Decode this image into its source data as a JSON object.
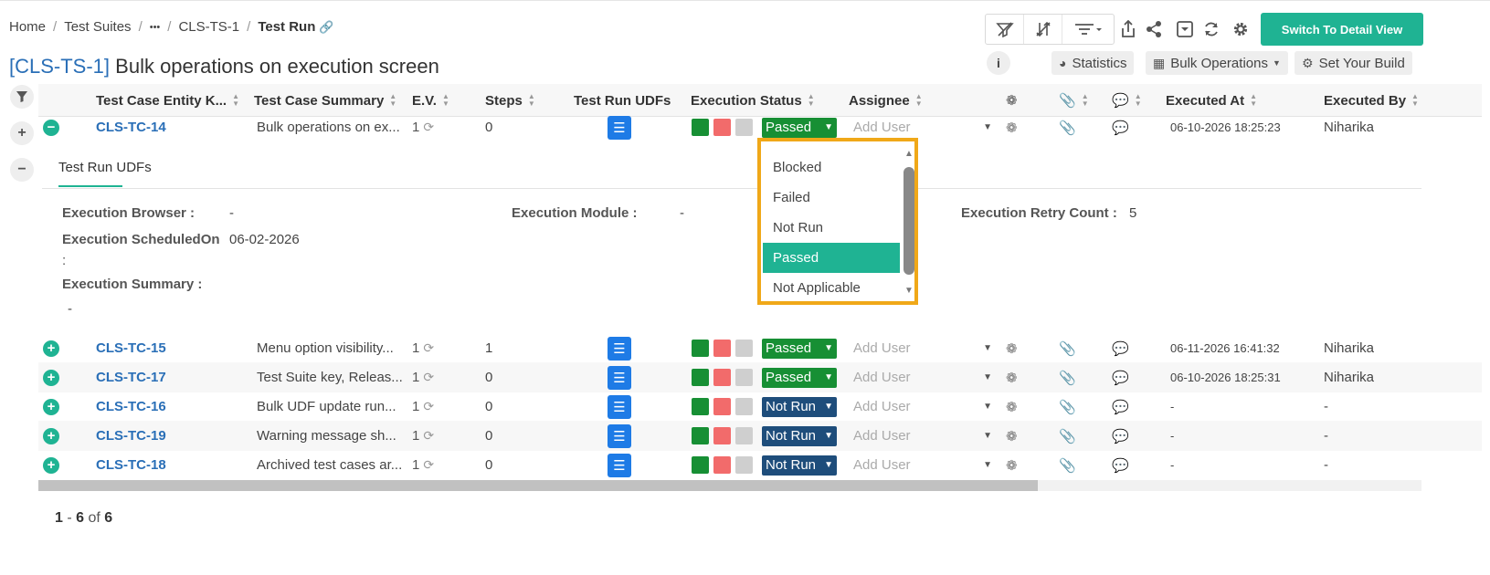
{
  "breadcrumb": {
    "home": "Home",
    "test_suites": "Test Suites",
    "ellipsis": "•••",
    "suite": "CLS-TS-1",
    "current": "Test Run"
  },
  "title": {
    "key": "[CLS-TS-1]",
    "text": "Bulk operations on execution screen"
  },
  "toolbar": {
    "switch_view": "Switch To Detail View",
    "statistics": "Statistics",
    "bulk_operations": "Bulk Operations",
    "set_build": "Set Your Build",
    "info": "i"
  },
  "columns": {
    "key": "Test Case Entity K...",
    "summary": "Test Case Summary",
    "ev": "E.V.",
    "steps": "Steps",
    "udfs": "Test Run UDFs",
    "status": "Execution Status",
    "assignee": "Assignee",
    "executed_at": "Executed At",
    "executed_by": "Executed By"
  },
  "rows": [
    {
      "key": "CLS-TC-14",
      "summary": "Bulk operations on ex...",
      "ev": "1",
      "steps": "0",
      "status": "Passed",
      "assignee": "Add User",
      "executed_at": "06-10-2026 18:25:23",
      "executed_by": "Niharika"
    },
    {
      "key": "CLS-TC-15",
      "summary": "Menu option visibility...",
      "ev": "1",
      "steps": "1",
      "status": "Passed",
      "assignee": "Add User",
      "executed_at": "06-11-2026 16:41:32",
      "executed_by": "Niharika"
    },
    {
      "key": "CLS-TC-17",
      "summary": "Test Suite key, Releas...",
      "ev": "1",
      "steps": "0",
      "status": "Passed",
      "assignee": "Add User",
      "executed_at": "06-10-2026 18:25:31",
      "executed_by": "Niharika"
    },
    {
      "key": "CLS-TC-16",
      "summary": "Bulk UDF update run...",
      "ev": "1",
      "steps": "0",
      "status": "Not Run",
      "assignee": "Add User",
      "executed_at": "-",
      "executed_by": "-"
    },
    {
      "key": "CLS-TC-19",
      "summary": "Warning message sh...",
      "ev": "1",
      "steps": "0",
      "status": "Not Run",
      "assignee": "Add User",
      "executed_at": "-",
      "executed_by": "-"
    },
    {
      "key": "CLS-TC-18",
      "summary": "Archived test cases ar...",
      "ev": "1",
      "steps": "0",
      "status": "Not Run",
      "assignee": "Add User",
      "executed_at": "-",
      "executed_by": "-"
    }
  ],
  "expanded": {
    "tab": "Test Run UDFs",
    "fields": {
      "browser_label": "Execution Browser :",
      "browser_value": "-",
      "module_label": "Execution Module :",
      "module_value": "-",
      "retry_label": "Execution Retry Count :",
      "retry_value": "5",
      "scheduled_label_1": "Execution ScheduledOn",
      "scheduled_label_2": ":",
      "scheduled_value": "06-02-2026",
      "summary_label": "Execution Summary :",
      "summary_value": "-"
    }
  },
  "dropdown": {
    "options": [
      "Blocked",
      "Failed",
      "Not Run",
      "Passed",
      "Not Applicable"
    ],
    "selected": "Passed"
  },
  "pager": {
    "from": "1",
    "dash": "-",
    "to": "6",
    "of": "of",
    "total": "6"
  },
  "colors": {
    "accent": "#1fb393",
    "passed": "#178f34",
    "not_run": "#1e4d7b",
    "highlight": "#f0a818",
    "link": "#2a6fb7"
  }
}
